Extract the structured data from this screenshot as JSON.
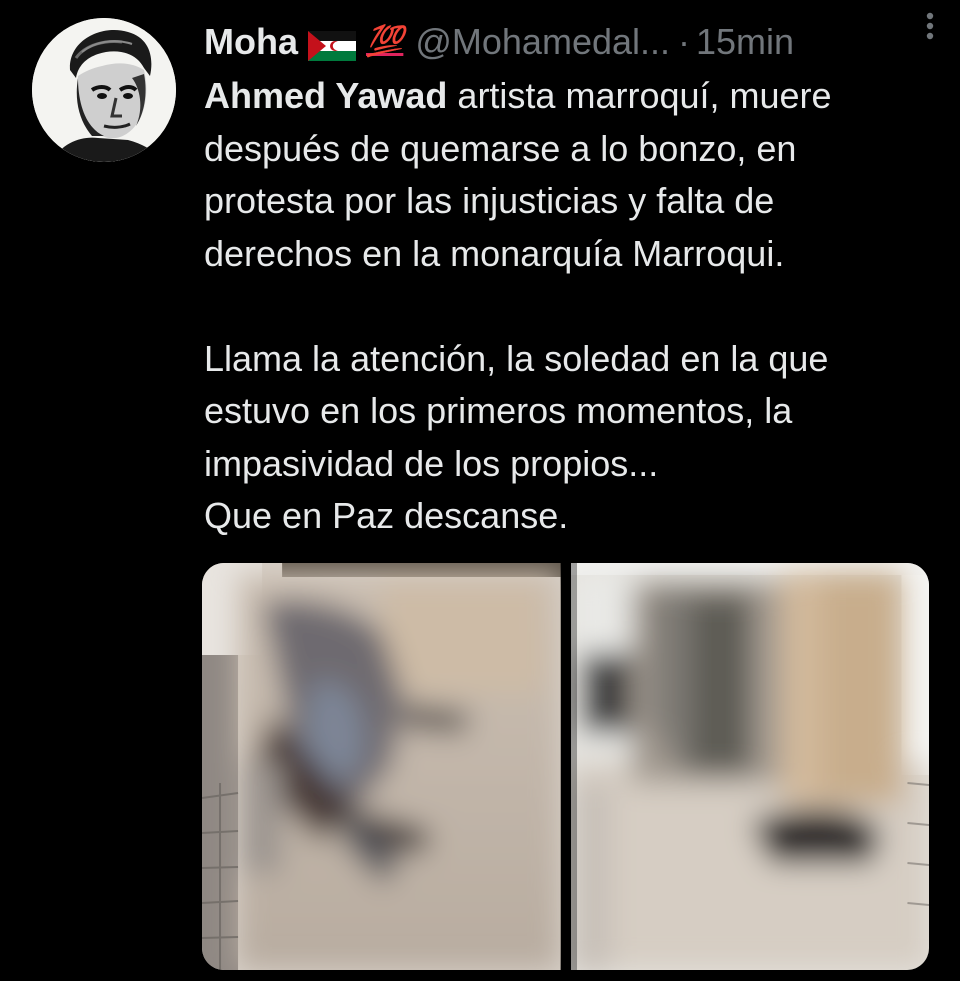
{
  "tweet": {
    "author": {
      "display_name": "Moha",
      "flag_icon": "western-sahara-flag-icon",
      "emoji": "💯",
      "handle": "@Mohamedal...",
      "separator": "·",
      "time": "15min"
    },
    "text": {
      "bold_lead": "Ahmed Yawad",
      "line1_rest": " artista marroquí, muere",
      "line2": "después de quemarse a lo bonzo, en",
      "line3": "protesta por las injusticias y falta de",
      "line4": "derechos en la monarquía Marroqui.",
      "line5": "Llama la atención, la soledad en la que",
      "line6": "estuvo en los primeros momentos, la",
      "line7": "impasividad de los propios...",
      "line8": "Que en Paz descanse."
    },
    "media": [
      {
        "icon": "blurred-photo-1",
        "description_color": "#9a8f86"
      },
      {
        "icon": "blurred-photo-2",
        "description_color": "#b8b0a8"
      }
    ],
    "colors": {
      "background": "#000000",
      "text": "#e7e9ea",
      "secondary": "#71767b"
    }
  }
}
